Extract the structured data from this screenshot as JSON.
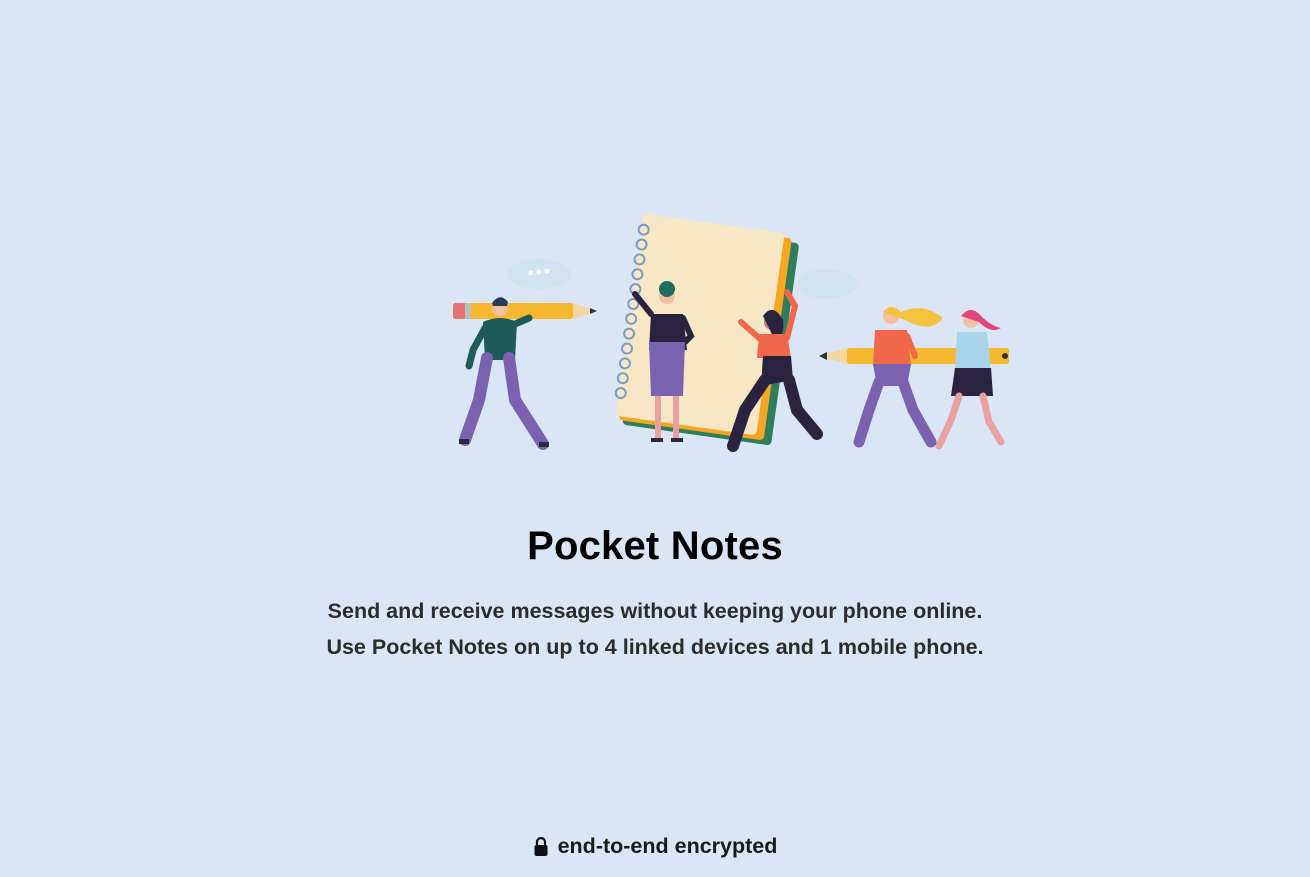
{
  "app": {
    "title": "Pocket Notes",
    "description_line1": "Send and receive messages without keeping your phone online.",
    "description_line2": "Use Pocket Notes on up to 4 linked devices and 1 mobile phone."
  },
  "footer": {
    "encryption_label": "end-to-end encrypted",
    "icon": "lock-icon"
  },
  "illustration": {
    "icon": "people-with-notebook-illustration"
  },
  "colors": {
    "background": "#dae5f5",
    "title": "#000000",
    "description": "#2c2c2c"
  }
}
